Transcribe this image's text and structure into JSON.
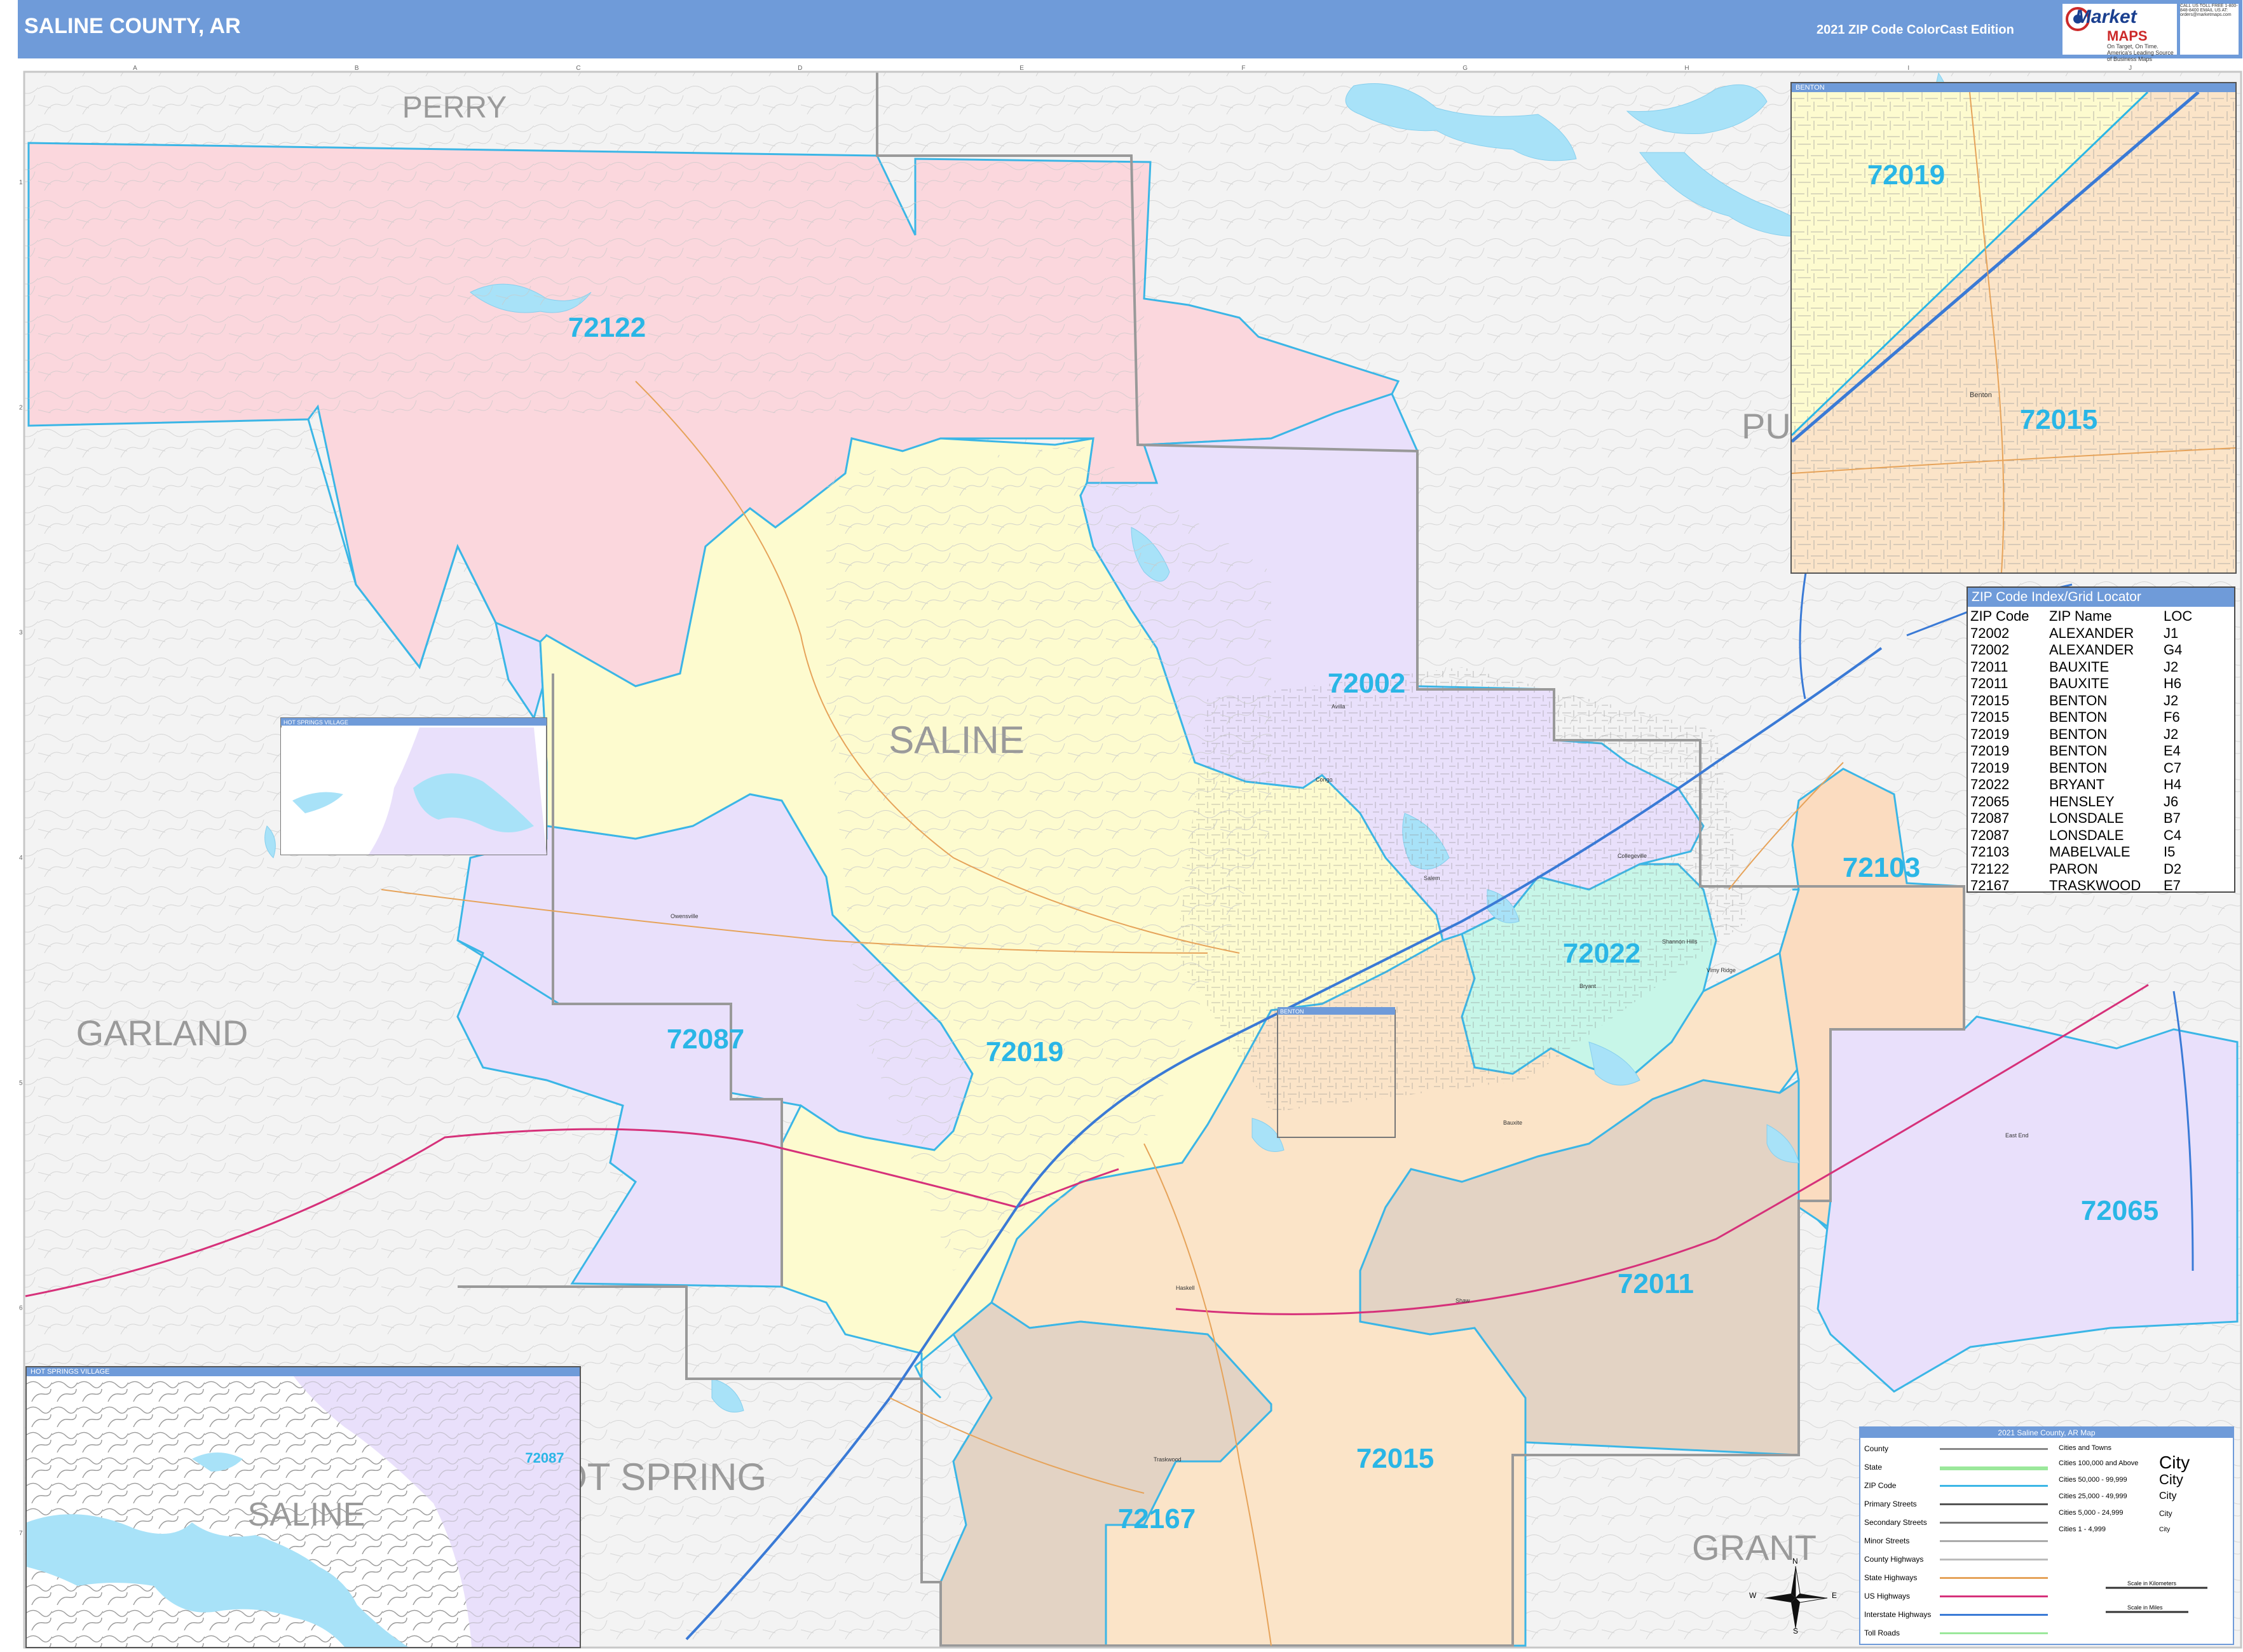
{
  "header": {
    "title": "SALINE COUNTY, AR",
    "edition": "2021 ZIP Code ColorCast Edition",
    "logo_word": "Market",
    "logo_maps": "MAPS",
    "logo_tagline": "On Target, On Time. America's Leading Source of Business Maps",
    "logo_contact": "CALL US TOLL FREE 1-800-848-8400 EMAIL US AT: orders@marketmaps.com"
  },
  "map": {
    "county_name": "SALINE",
    "neighbor_counties": [
      "PERRY",
      "GARLAND",
      "HOT SPRING",
      "GRANT",
      "PU"
    ],
    "zip_labels": [
      "72122",
      "72002",
      "72019",
      "72087",
      "72022",
      "72103",
      "72065",
      "72011",
      "72015",
      "72167"
    ],
    "zip_colors": {
      "72122": "#fbd7dd",
      "72087": "#e9e0fb",
      "72019": "#fdfbcf",
      "72002": "#e9e0fb",
      "72022": "#c7f6e8",
      "72103": "#fbdcc0",
      "72065": "#e9e0fb",
      "72011": "#e3d3c4",
      "72015": "#fbe4c8",
      "72167": "#e3d3c4"
    },
    "outside_color": "#f3f3f3",
    "water_color": "#a8e2f8",
    "zip_label_color": "#2ab6e6"
  },
  "insets": {
    "benton": {
      "title": "BENTON",
      "zips": [
        "72019",
        "72015"
      ],
      "town": "Benton"
    },
    "hot_springs_village": {
      "title": "HOT SPRINGS VILLAGE",
      "county_label": "SALINE",
      "zip": "72087"
    },
    "hsv_small_title": "HOT SPRINGS VILLAGE",
    "benton_small_title": "BENTON"
  },
  "zip_index": {
    "title": "ZIP Code Index/Grid Locator",
    "columns": [
      "ZIP Code",
      "ZIP Name",
      "LOC"
    ],
    "rows": [
      [
        "72002",
        "ALEXANDER",
        "J1"
      ],
      [
        "72002",
        "ALEXANDER",
        "G4"
      ],
      [
        "72011",
        "BAUXITE",
        "J2"
      ],
      [
        "72011",
        "BAUXITE",
        "H6"
      ],
      [
        "72015",
        "BENTON",
        "J2"
      ],
      [
        "72015",
        "BENTON",
        "F6"
      ],
      [
        "72019",
        "BENTON",
        "J2"
      ],
      [
        "72019",
        "BENTON",
        "E4"
      ],
      [
        "72019",
        "BENTON",
        "C7"
      ],
      [
        "72022",
        "BRYANT",
        "H4"
      ],
      [
        "72065",
        "HENSLEY",
        "J6"
      ],
      [
        "72087",
        "LONSDALE",
        "B7"
      ],
      [
        "72087",
        "LONSDALE",
        "C4"
      ],
      [
        "72103",
        "MABELVALE",
        "I5"
      ],
      [
        "72122",
        "PARON",
        "D2"
      ],
      [
        "72167",
        "TRASKWOOD",
        "E7"
      ]
    ]
  },
  "legend": {
    "title": "2021 Saline County, AR Map",
    "left_items": [
      "County",
      "State",
      "ZIP Code",
      "Primary Streets",
      "Secondary Streets",
      "Minor Streets",
      "County Highways",
      "State Highways",
      "US Highways",
      "Interstate Highways",
      "Toll Roads"
    ],
    "left_colors": [
      "#888888",
      "#9be89b",
      "#3bb6e6",
      "#555555",
      "#777777",
      "#aaaaaa",
      "#bbbbbb",
      "#e6a35a",
      "#d6317a",
      "#3a7ad6",
      "#9be89b"
    ],
    "cities_title": "Cities and Towns",
    "city_items": [
      "Cities 100,000 and Above",
      "Cities 50,000 - 99,999",
      "Cities 25,000 - 49,999",
      "Cities 5,000 - 24,999",
      "Cities 1 - 4,999"
    ],
    "city_symbol": "City",
    "scale_km": "Scale in Kilometers",
    "scale_mi": "Scale in Miles"
  },
  "compass": {
    "n": "N",
    "s": "S",
    "e": "E",
    "w": "W"
  },
  "grid": {
    "letters": [
      "A",
      "B",
      "C",
      "D",
      "E",
      "F",
      "G",
      "H",
      "I",
      "J"
    ],
    "numbers": [
      "1",
      "2",
      "3",
      "4",
      "5",
      "6",
      "7"
    ]
  },
  "towns": [
    "Avilla",
    "Congo",
    "Salem",
    "Collegeville",
    "Bryant",
    "Shannon Hills",
    "Vimy Ridge",
    "Bauxite",
    "Shaw",
    "Traskwood",
    "Haskell",
    "East End",
    "Owensville"
  ]
}
